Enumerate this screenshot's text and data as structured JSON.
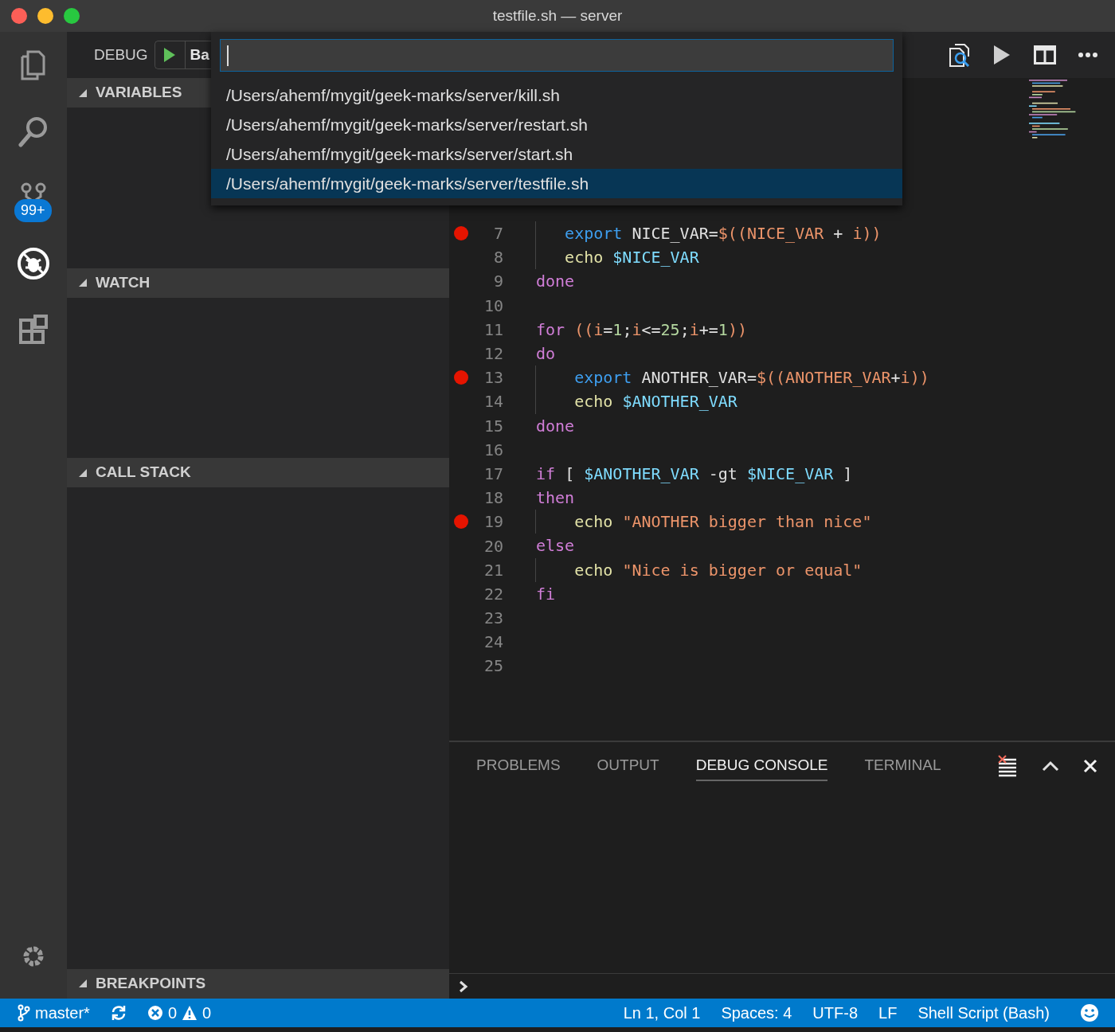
{
  "window": {
    "title": "testfile.sh — server"
  },
  "activity_bar": {
    "items": [
      {
        "kind": "explorer",
        "selected": false
      },
      {
        "kind": "search",
        "selected": false
      },
      {
        "kind": "scm",
        "selected": false,
        "badge": "99+"
      },
      {
        "kind": "debug",
        "selected": true
      },
      {
        "kind": "extensions",
        "selected": false
      }
    ]
  },
  "sidebar": {
    "title": "DEBUG",
    "config": "Ba",
    "sections": [
      {
        "title": "VARIABLES",
        "expanded": true
      },
      {
        "title": "WATCH",
        "expanded": true
      },
      {
        "title": "CALL STACK",
        "expanded": true
      },
      {
        "title": "BREAKPOINTS",
        "expanded": true
      }
    ]
  },
  "quick_pick": {
    "items": [
      {
        "label": "/Users/ahemf/mygit/geek-marks/server/kill.sh",
        "selected": false
      },
      {
        "label": "/Users/ahemf/mygit/geek-marks/server/restart.sh",
        "selected": false
      },
      {
        "label": "/Users/ahemf/mygit/geek-marks/server/start.sh",
        "selected": false
      },
      {
        "label": "/Users/ahemf/mygit/geek-marks/server/testfile.sh",
        "selected": true
      }
    ]
  },
  "editor": {
    "lines": [
      {
        "number": "7",
        "breakpoint": true,
        "tokens": [
          {
            "kind": "builtin",
            "text": "   export"
          },
          {
            "kind": "plain",
            "text": " NICE_VAR="
          },
          {
            "kind": "expansion",
            "text": "$((NICE_VAR "
          },
          {
            "kind": "plain",
            "text": "+"
          },
          {
            "kind": "expansion",
            "text": " i))"
          }
        ]
      },
      {
        "number": "8",
        "breakpoint": false,
        "tokens": [
          {
            "kind": "command",
            "text": "   echo "
          },
          {
            "kind": "variable",
            "text": "$NICE_VAR"
          }
        ]
      },
      {
        "number": "9",
        "breakpoint": false,
        "tokens": [
          {
            "kind": "keyword",
            "text": "done"
          }
        ]
      },
      {
        "number": "10",
        "breakpoint": false
      },
      {
        "number": "11",
        "breakpoint": false,
        "tokens": [
          {
            "kind": "keyword",
            "text": "for "
          },
          {
            "kind": "expansion",
            "text": "((i"
          },
          {
            "kind": "plain",
            "text": "="
          },
          {
            "kind": "number",
            "text": "1"
          },
          {
            "kind": "plain",
            "text": ";"
          },
          {
            "kind": "expansion",
            "text": "i"
          },
          {
            "kind": "plain",
            "text": "<="
          },
          {
            "kind": "number",
            "text": "25"
          },
          {
            "kind": "plain",
            "text": ";"
          },
          {
            "kind": "expansion",
            "text": "i"
          },
          {
            "kind": "plain",
            "text": "+="
          },
          {
            "kind": "number",
            "text": "1"
          },
          {
            "kind": "expansion",
            "text": "))"
          }
        ]
      },
      {
        "number": "12",
        "breakpoint": false,
        "tokens": [
          {
            "kind": "keyword",
            "text": "do"
          }
        ]
      },
      {
        "number": "13",
        "breakpoint": true,
        "tokens": [
          {
            "kind": "builtin",
            "text": "    export"
          },
          {
            "kind": "plain",
            "text": " ANOTHER_VAR="
          },
          {
            "kind": "expansion",
            "text": "$((ANOTHER_VAR"
          },
          {
            "kind": "plain",
            "text": "+"
          },
          {
            "kind": "expansion",
            "text": "i))"
          }
        ]
      },
      {
        "number": "14",
        "breakpoint": false,
        "tokens": [
          {
            "kind": "command",
            "text": "    echo "
          },
          {
            "kind": "variable",
            "text": "$ANOTHER_VAR"
          }
        ]
      },
      {
        "number": "15",
        "breakpoint": false,
        "tokens": [
          {
            "kind": "keyword",
            "text": "done"
          }
        ]
      },
      {
        "number": "16",
        "breakpoint": false
      },
      {
        "number": "17",
        "breakpoint": false,
        "tokens": [
          {
            "kind": "keyword",
            "text": "if"
          },
          {
            "kind": "plain",
            "text": " [ "
          },
          {
            "kind": "variable",
            "text": "$ANOTHER_VAR"
          },
          {
            "kind": "plain",
            "text": " -gt "
          },
          {
            "kind": "variable",
            "text": "$NICE_VAR"
          },
          {
            "kind": "plain",
            "text": " ]"
          }
        ]
      },
      {
        "number": "18",
        "breakpoint": false,
        "tokens": [
          {
            "kind": "keyword",
            "text": "then"
          }
        ]
      },
      {
        "number": "19",
        "breakpoint": true,
        "tokens": [
          {
            "kind": "command",
            "text": "    echo "
          },
          {
            "kind": "string",
            "text": "\"ANOTHER bigger than nice\""
          }
        ]
      },
      {
        "number": "20",
        "breakpoint": false,
        "tokens": [
          {
            "kind": "keyword",
            "text": "else"
          }
        ]
      },
      {
        "number": "21",
        "breakpoint": false,
        "tokens": [
          {
            "kind": "command",
            "text": "    echo "
          },
          {
            "kind": "string",
            "text": "\"Nice is bigger or equal\""
          }
        ]
      },
      {
        "number": "22",
        "breakpoint": false,
        "tokens": [
          {
            "kind": "keyword",
            "text": "fi"
          }
        ]
      },
      {
        "number": "23",
        "breakpoint": false
      },
      {
        "number": "24",
        "breakpoint": false
      },
      {
        "number": "25",
        "breakpoint": false
      }
    ]
  },
  "panel": {
    "tabs": [
      {
        "label": "PROBLEMS",
        "selected": false
      },
      {
        "label": "OUTPUT",
        "selected": false
      },
      {
        "label": "DEBUG CONSOLE",
        "selected": true
      },
      {
        "label": "TERMINAL",
        "selected": false
      }
    ]
  },
  "status_bar": {
    "branch": "master*",
    "errors": "0",
    "warnings": "0",
    "right": [
      "Ln 1, Col 1",
      "Spaces: 4",
      "UTF-8",
      "LF",
      "Shell Script (Bash)"
    ]
  }
}
